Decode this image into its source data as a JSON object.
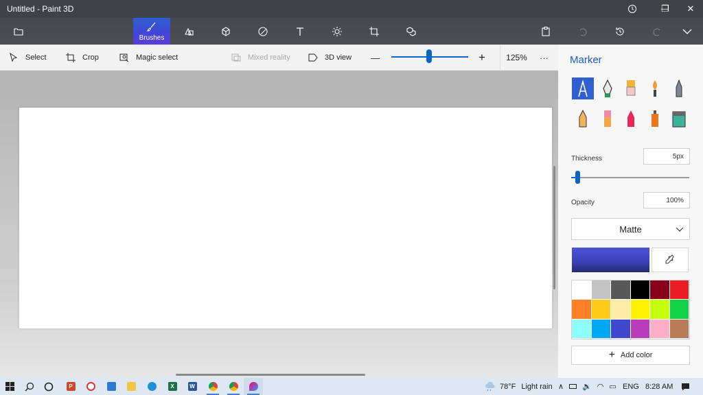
{
  "window": {
    "title": "Untitled - Paint 3D",
    "controls": {
      "minimize": "—",
      "restore": "❐",
      "close": "✕"
    }
  },
  "toolbar": {
    "active_label": "Brushes",
    "tools": [
      "folder-icon",
      "brushes-icon",
      "2d-shapes-icon",
      "3d-shapes-icon",
      "stickers-icon",
      "text-icon",
      "effects-icon",
      "canvas-icon",
      "3d-library-icon"
    ],
    "right": [
      "paste-icon",
      "undo-icon",
      "history-icon",
      "redo-icon",
      "expand-menu-icon"
    ]
  },
  "subbar": {
    "select": "Select",
    "crop": "Crop",
    "magic_select": "Magic select",
    "mixed_reality": "Mixed reality",
    "view_3d": "3D view",
    "zoom_minus": "—",
    "zoom_plus": "+",
    "zoom": "125%",
    "zoom_level_fraction": 0.5,
    "more": "···"
  },
  "panel": {
    "title": "Marker",
    "brushes": [
      "marker",
      "calligraphy-pen",
      "oil-brush",
      "watercolor",
      "pixel-pen",
      "pencil",
      "eraser",
      "crayon",
      "spray-can",
      "fill"
    ],
    "thickness_label": "Thickness",
    "thickness_value": "5px",
    "opacity_label": "Opacity",
    "opacity_value": "100%",
    "finish": "Matte",
    "current_color": "#4a55d8",
    "add_color": "Add color",
    "palette": [
      "#ffffff",
      "#c3c3c3",
      "#585858",
      "#000000",
      "#88001b",
      "#ec1c24",
      "#ff7f27",
      "#ffca18",
      "#fdeca6",
      "#fff200",
      "#c4ff0e",
      "#0ed145",
      "#8cfffb",
      "#00a8f3",
      "#3f48cc",
      "#b83dba",
      "#ffaec8",
      "#b97a56"
    ]
  },
  "taskbar": {
    "apps": [
      "windows-start-icon",
      "search-icon",
      "task-view-icon",
      "powerpoint-icon",
      "chrome-red-icon",
      "monitor-icon",
      "file-explorer-icon",
      "edge-icon",
      "excel-icon",
      "word-icon",
      "chrome-icon",
      "chrome-icon-2",
      "paint-3d-icon"
    ],
    "temperature": "78°F",
    "weather": "Light rain",
    "lang": "ENG",
    "time": "8:28 AM"
  }
}
